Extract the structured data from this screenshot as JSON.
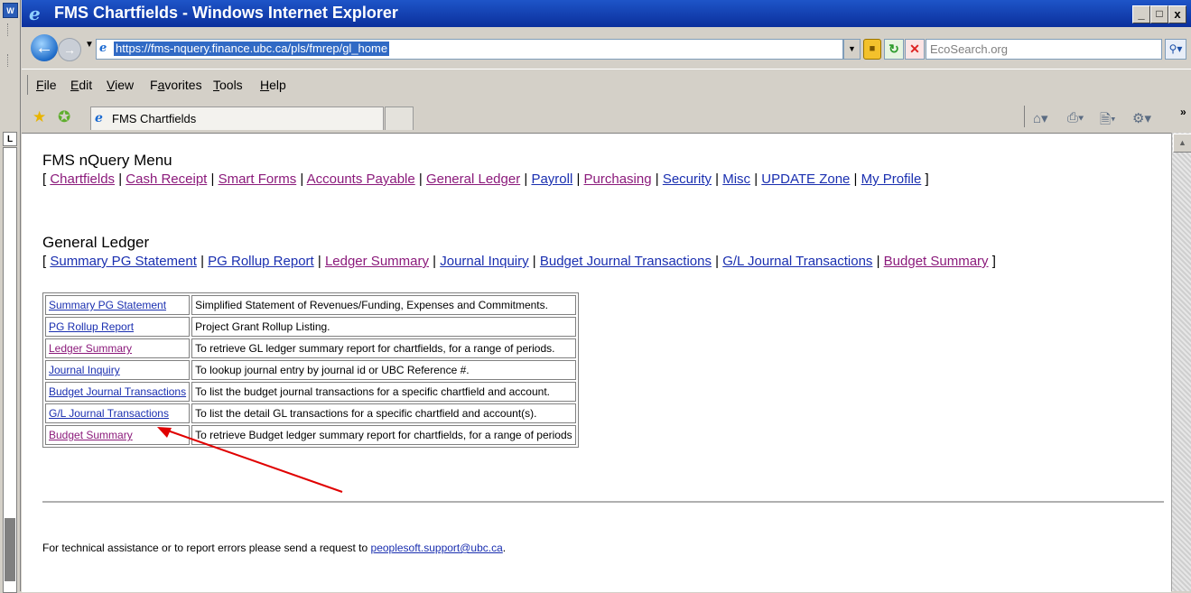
{
  "window": {
    "title": "FMS Chartfields - Windows Internet Explorer",
    "controls": [
      "_",
      "□",
      "x"
    ]
  },
  "address_bar": {
    "url": "https://fms-nquery.finance.ubc.ca/pls/fmrep/gl_home",
    "search_placeholder": "EcoSearch.org"
  },
  "menu": {
    "items": [
      "File",
      "Edit",
      "View",
      "Favorites",
      "Tools",
      "Help"
    ],
    "underline": [
      "F",
      "E",
      "V",
      "a",
      "T",
      "H"
    ]
  },
  "tabs": {
    "active_label": "FMS Chartfields"
  },
  "page": {
    "menu_title": "FMS nQuery Menu",
    "main_nav": [
      {
        "label": "Chartfields",
        "visited": true
      },
      {
        "label": "Cash Receipt",
        "visited": true
      },
      {
        "label": "Smart Forms",
        "visited": true
      },
      {
        "label": "Accounts Payable",
        "visited": true
      },
      {
        "label": "General Ledger",
        "visited": true
      },
      {
        "label": "Payroll",
        "visited": false
      },
      {
        "label": "Purchasing",
        "visited": true
      },
      {
        "label": "Security",
        "visited": false
      },
      {
        "label": "Misc",
        "visited": false
      },
      {
        "label": "UPDATE Zone",
        "visited": false
      },
      {
        "label": "My Profile",
        "visited": false
      }
    ],
    "section_title": "General Ledger",
    "gl_nav": [
      {
        "label": "Summary PG Statement",
        "visited": false
      },
      {
        "label": "PG Rollup Report",
        "visited": false
      },
      {
        "label": "Ledger Summary",
        "visited": true
      },
      {
        "label": "Journal Inquiry",
        "visited": false
      },
      {
        "label": "Budget Journal Transactions",
        "visited": false
      },
      {
        "label": "G/L Journal Transactions",
        "visited": false
      },
      {
        "label": "Budget Summary",
        "visited": true
      }
    ],
    "table_rows": [
      {
        "link": "Summary PG Statement",
        "visited": false,
        "desc": "Simplified Statement of Revenues/Funding, Expenses and Commitments."
      },
      {
        "link": "PG Rollup Report",
        "visited": false,
        "desc": "Project Grant Rollup Listing."
      },
      {
        "link": "Ledger Summary",
        "visited": true,
        "desc": "To retrieve GL ledger summary report for chartfields, for a range of periods."
      },
      {
        "link": "Journal Inquiry",
        "visited": false,
        "desc": "To lookup journal entry by journal id or UBC Reference #."
      },
      {
        "link": "Budget Journal Transactions",
        "visited": false,
        "desc": "To list the budget journal transactions for a specific chartfield and account."
      },
      {
        "link": "G/L Journal Transactions",
        "visited": false,
        "desc": "To list the detail GL transactions for a specific chartfield and account(s)."
      },
      {
        "link": "Budget Summary",
        "visited": true,
        "desc": "To retrieve Budget ledger summary report for chartfields, for a range of periods"
      }
    ],
    "footer_text": "For technical assistance or to report errors please send a request to ",
    "footer_email": "peoplesoft.support@ubc.ca",
    "footer_end": "."
  },
  "colors": {
    "visited_link": "#8b1a7b",
    "link": "#1a2fb0",
    "annotation_arrow": "#e00000"
  }
}
